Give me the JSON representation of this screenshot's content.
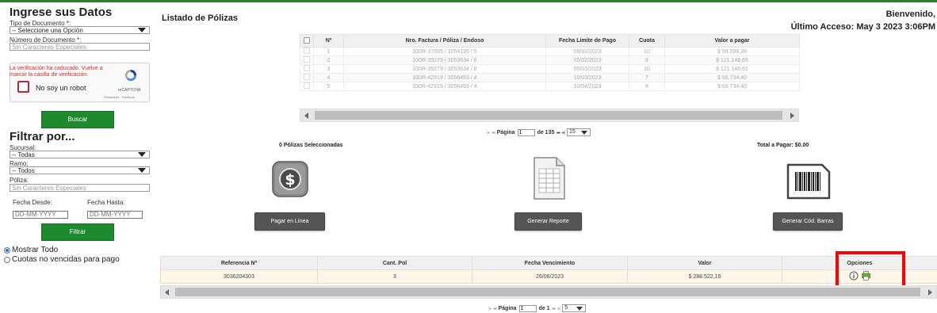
{
  "sidebar": {
    "title": "Ingrese sus Datos",
    "doc_type_label": "Tipo de Documento *:",
    "doc_type_value": "-- Seleccione una Opción",
    "doc_number_label": "Número de Documento *:",
    "doc_number_placeholder": "Sin Caracteres Especiales",
    "captcha_error": "La verificación ha caducado. Vuelve a marcar la casilla de verificación.",
    "captcha_text": "No soy un robot",
    "captcha_brand": "reCAPTCHA",
    "captcha_terms": "Privacidad - Términos",
    "search_button": "Buscar",
    "filter_title": "Filtrar por...",
    "branch_label": "Sucursal:",
    "branch_value": "-- Todas",
    "line_label": "Ramo:",
    "line_value": "-- Todos",
    "policy_label": "Póliza:",
    "policy_placeholder": "Sin Caracteres Especiales",
    "date_from_label": "Fecha Desde:",
    "date_from_placeholder": "DD-MM-YYYY",
    "date_to_label": "Fecha Hasta:",
    "date_to_placeholder": "DD-MM-YYYY",
    "filter_button": "Filtrar",
    "radio_show_all": "Mostrar Todo",
    "radio_not_due": "Cuotas no vencidas para pago"
  },
  "header": {
    "title": "Listado de Pólizas",
    "welcome": "Bienvenido,",
    "last_access": "Último Acceso: May 3 2023 3:06PM"
  },
  "policies": {
    "columns": [
      "Nº",
      "Nro. Factura / Póliza / Endoso",
      "Fecha Limite de Pago",
      "Cuota",
      "Valor a pagar"
    ],
    "rows": [
      [
        "1",
        "330R-37695 / 3054195 / 5",
        "08/02/2023",
        "10",
        "$ 59.596,38"
      ],
      [
        "2",
        "330R-39279 / 3053634 / 6",
        "05/02/2023",
        "9",
        "$ 121.148,65"
      ],
      [
        "3",
        "330R-39279 / 3053634 / 6",
        "05/03/2023",
        "10",
        "$ 121.148,61"
      ],
      [
        "4",
        "330R-42919 / 3056453 / 4",
        "10/03/2023",
        "7",
        "$ 66.734,40"
      ],
      [
        "5",
        "330R-42919 / 3056453 / 4",
        "10/04/2023",
        "8",
        "$ 66.734,40"
      ]
    ],
    "pager": {
      "page_label": "Página",
      "page_value": "1",
      "of_label": "de 135",
      "page_size": "15"
    }
  },
  "selection": {
    "selected_text": "0 Pólizas Seleccionadas",
    "total_text": "Total a Pagar: $0.00"
  },
  "actions": {
    "pay_online": "Pagar en Línea",
    "generate_report": "Generar Reporte",
    "generate_barcode": "Generar Cód. Barras"
  },
  "summary": {
    "columns": [
      "Referencia Nº",
      "Cant. Pol",
      "Fecha Vencimiento",
      "Valor",
      "Opciones"
    ],
    "row": [
      "3036204303",
      "3",
      "26/06/2023",
      "$ 288.522,16"
    ],
    "pager": {
      "page_label": "Página",
      "page_value": "1",
      "of_label": "de 1",
      "page_size": "5"
    }
  },
  "colors": {
    "brand_green": "#1e8a2e",
    "highlight_red": "#ff0000",
    "dark_button": "#555555"
  }
}
